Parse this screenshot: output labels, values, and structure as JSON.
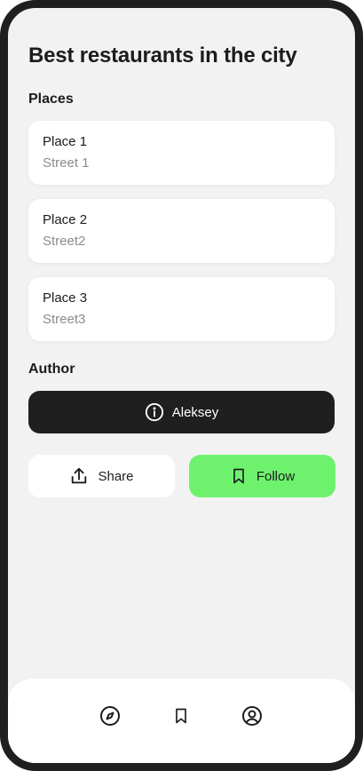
{
  "page": {
    "title": "Best restaurants in the city"
  },
  "places": {
    "label": "Places",
    "items": [
      {
        "name": "Place 1",
        "street": "Street 1"
      },
      {
        "name": "Place 2",
        "street": "Street2"
      },
      {
        "name": "Place 3",
        "street": "Street3"
      }
    ]
  },
  "author": {
    "label": "Author",
    "name": "Aleksey",
    "icon": "info-icon"
  },
  "actions": {
    "share_label": "Share",
    "share_icon": "share-icon",
    "follow_label": "Follow",
    "follow_icon": "bookmark-icon"
  },
  "bottom_nav": {
    "items": [
      {
        "icon": "compass-icon"
      },
      {
        "icon": "bookmark-icon"
      },
      {
        "icon": "user-icon"
      }
    ]
  },
  "colors": {
    "frame": "#1f1f1f",
    "background": "#f2f2f2",
    "card": "#ffffff",
    "author_button": "#1f1f1f",
    "follow_accent": "#6ef26e",
    "secondary_text": "#8c8c8c"
  }
}
